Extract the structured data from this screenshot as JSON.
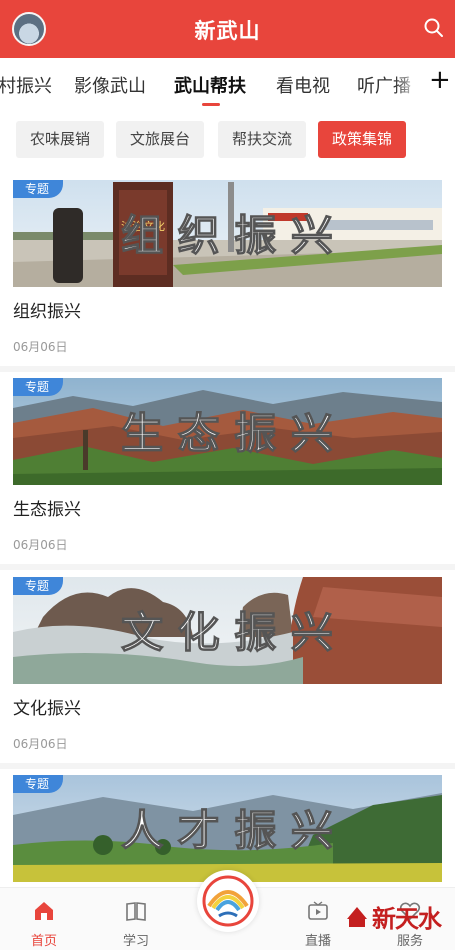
{
  "header": {
    "title": "新武山"
  },
  "tabs": [
    {
      "label": "村振兴"
    },
    {
      "label": "影像武山"
    },
    {
      "label": "武山帮扶"
    },
    {
      "label": "看电视"
    },
    {
      "label": "听广播"
    }
  ],
  "tabs_more": "+",
  "chips": [
    {
      "label": "农味展销"
    },
    {
      "label": "文旅展台"
    },
    {
      "label": "帮扶交流"
    },
    {
      "label": "政策集锦"
    }
  ],
  "cards": [
    {
      "badge": "专题",
      "banner": "组 织 振 兴",
      "sign": "法治文化",
      "title": "组织振兴",
      "date": "06月06日"
    },
    {
      "badge": "专题",
      "banner": "生 态 振 兴",
      "title": "生态振兴",
      "date": "06月06日"
    },
    {
      "badge": "专题",
      "banner": "文 化 振 兴",
      "title": "文化振兴",
      "date": "06月06日"
    },
    {
      "badge": "专题",
      "banner": "人 才 振 兴"
    }
  ],
  "bottom_nav": [
    {
      "label": "首页"
    },
    {
      "label": "学习"
    },
    {
      "label": "直播"
    },
    {
      "label": "服务"
    }
  ],
  "watermark": {
    "text": "新天水"
  },
  "colors": {
    "brand": "#e8453c",
    "badge": "#3f86d9"
  }
}
